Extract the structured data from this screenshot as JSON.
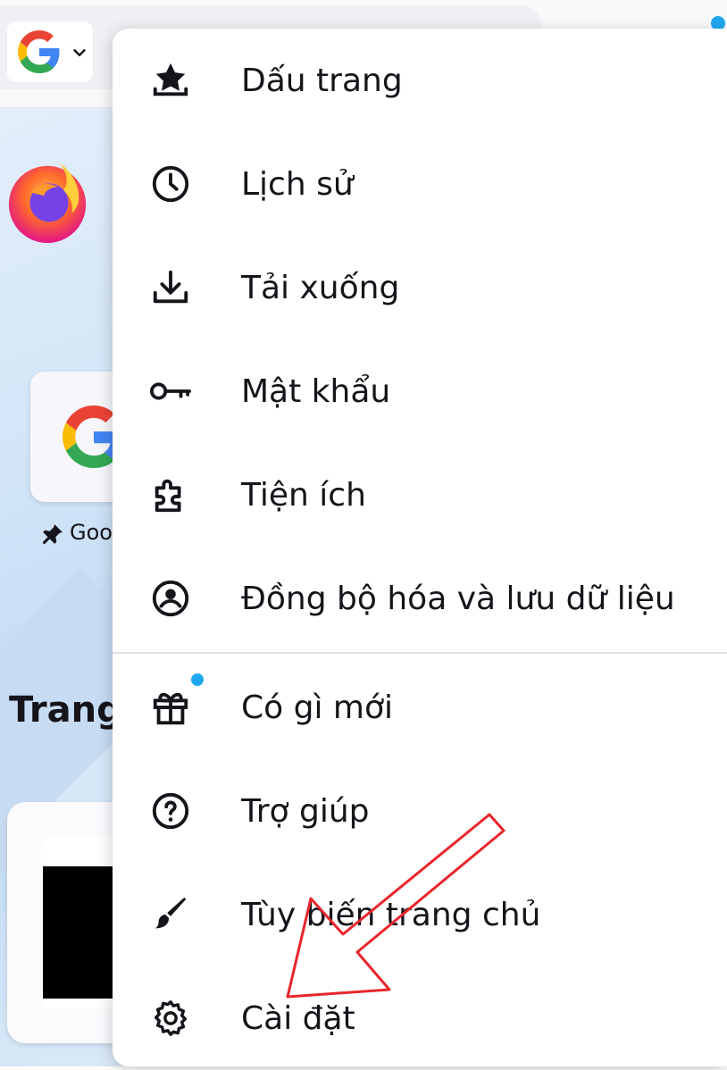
{
  "toolbar": {
    "search_engine": "Google",
    "engine_icon": "google-logo",
    "dropdown_icon": "chevron-down-icon"
  },
  "homepage": {
    "shortcut_label": "Goo",
    "section_title": "Trang"
  },
  "menu": {
    "items": [
      {
        "label": "Dấu trang",
        "icon": "bookmark-star-icon"
      },
      {
        "label": "Lịch sử",
        "icon": "clock-icon"
      },
      {
        "label": "Tải xuống",
        "icon": "download-icon"
      },
      {
        "label": "Mật khẩu",
        "icon": "key-icon"
      },
      {
        "label": "Tiện ích",
        "icon": "puzzle-icon"
      },
      {
        "label": "Đồng bộ hóa và lưu dữ liệu",
        "icon": "account-icon"
      },
      {
        "label": "Có gì mới",
        "icon": "gift-icon"
      },
      {
        "label": "Trợ giúp",
        "icon": "help-icon"
      },
      {
        "label": "Tùy biến trang chủ",
        "icon": "brush-icon"
      },
      {
        "label": "Cài đặt",
        "icon": "gear-icon"
      }
    ]
  },
  "colors": {
    "accent_dot": "#1ea7f0",
    "annotation_arrow": "#e8262c",
    "text": "#15141a"
  }
}
